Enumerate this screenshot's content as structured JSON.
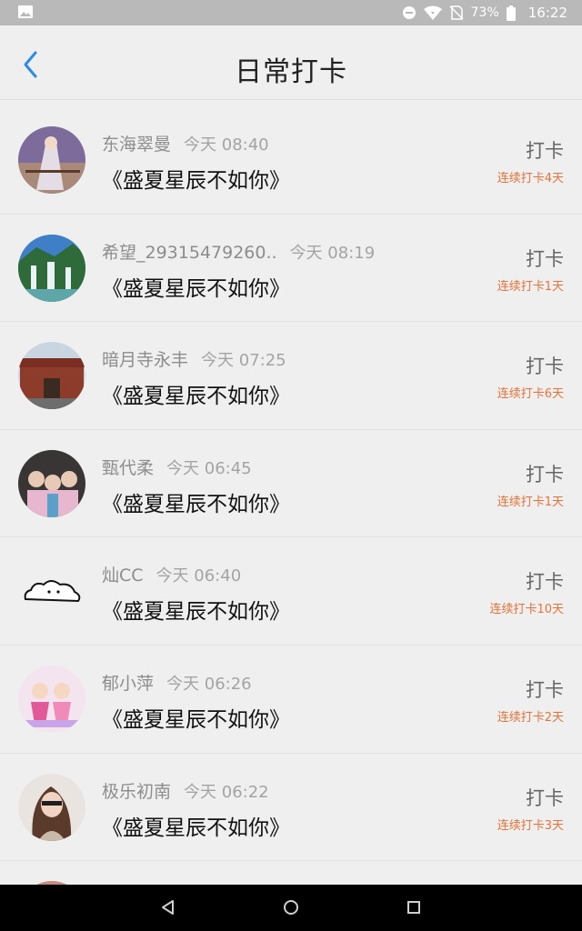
{
  "status_bar": {
    "battery_percent": "73%",
    "time": "16:22"
  },
  "header": {
    "title": "日常打卡"
  },
  "feed": [
    {
      "name": "东海翠曼",
      "time": "今天 08:40",
      "book": "《盛夏星辰不如你》",
      "action": "打卡",
      "streak": "连续打卡4天"
    },
    {
      "name": "希望_29315479260..",
      "time": "今天 08:19",
      "book": "《盛夏星辰不如你》",
      "action": "打卡",
      "streak": "连续打卡1天"
    },
    {
      "name": "暗月寺永丰",
      "time": "今天 07:25",
      "book": "《盛夏星辰不如你》",
      "action": "打卡",
      "streak": "连续打卡6天"
    },
    {
      "name": "甄代柔",
      "time": "今天 06:45",
      "book": "《盛夏星辰不如你》",
      "action": "打卡",
      "streak": "连续打卡1天"
    },
    {
      "name": "灿CC",
      "time": "今天 06:40",
      "book": "《盛夏星辰不如你》",
      "action": "打卡",
      "streak": "连续打卡10天"
    },
    {
      "name": "郁小萍",
      "time": "今天 06:26",
      "book": "《盛夏星辰不如你》",
      "action": "打卡",
      "streak": "连续打卡2天"
    },
    {
      "name": "极乐初南",
      "time": "今天 06:22",
      "book": "《盛夏星辰不如你》",
      "action": "打卡",
      "streak": "连续打卡3天"
    }
  ],
  "colors": {
    "accent_blue": "#2d8ae6",
    "streak_orange": "#e8733a"
  }
}
